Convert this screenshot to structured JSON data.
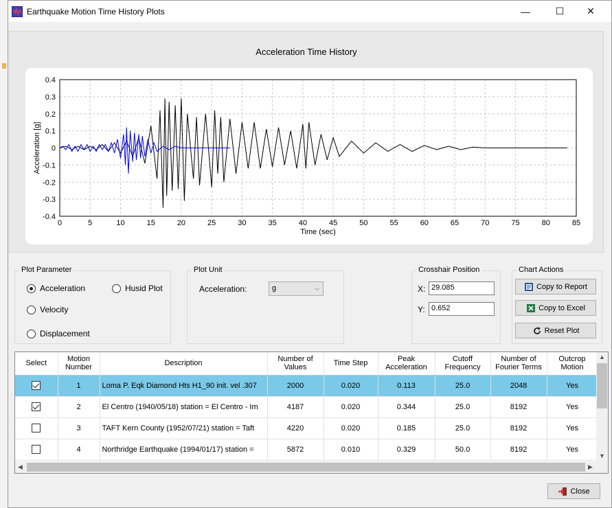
{
  "window": {
    "title": "Earthquake Motion Time History Plots",
    "controls": {
      "minimize": "—",
      "maximize": "☐",
      "close": "✕"
    }
  },
  "chart_data": {
    "type": "line",
    "title": "Acceleration Time History",
    "xlabel": "Time (sec)",
    "ylabel": "Acceleration [g]",
    "xlim": [
      0,
      85
    ],
    "ylim": [
      -0.4,
      0.4
    ],
    "xticks": [
      "0",
      "5",
      "10",
      "15",
      "20",
      "25",
      "30",
      "35",
      "40",
      "45",
      "50",
      "55",
      "60",
      "65",
      "70",
      "75",
      "80",
      "85"
    ],
    "yticks": [
      "0.4",
      "0.3",
      "0.2",
      "0.1",
      "0",
      "-0.1",
      "-0.2",
      "-0.3",
      "-0.4"
    ],
    "grid": true,
    "series": [
      {
        "color": "#000000",
        "x": [
          0,
          1,
          2,
          3,
          4,
          5,
          6,
          7,
          8,
          9,
          10,
          11,
          12,
          13,
          14,
          15,
          16,
          16.5,
          17,
          17.3,
          17.6,
          18,
          18.5,
          19,
          19.5,
          20,
          20.5,
          21,
          22,
          22.5,
          23,
          24,
          25,
          25.5,
          26,
          26.5,
          27,
          28,
          29,
          30,
          31,
          32,
          33,
          34,
          35,
          36,
          37,
          38,
          39,
          40,
          40.5,
          41,
          42,
          43,
          44,
          45,
          46,
          48,
          50,
          52,
          54,
          56,
          58,
          60,
          62,
          64,
          66,
          68,
          70,
          75,
          80,
          83.5
        ],
        "y": [
          0,
          0.01,
          -0.01,
          0.01,
          -0.01,
          0.01,
          -0.01,
          0.02,
          -0.02,
          0.03,
          -0.03,
          0.04,
          -0.05,
          0.06,
          -0.09,
          0.13,
          -0.18,
          0.22,
          -0.35,
          0.29,
          -0.28,
          0.27,
          -0.25,
          0.25,
          -0.24,
          0.29,
          -0.31,
          0.2,
          -0.18,
          0.18,
          -0.22,
          0.2,
          -0.23,
          0.22,
          -0.15,
          0.18,
          -0.2,
          0.17,
          -0.15,
          0.15,
          -0.12,
          0.15,
          -0.12,
          0.11,
          -0.11,
          0.12,
          -0.1,
          0.1,
          -0.12,
          0.14,
          -0.12,
          0.15,
          -0.1,
          0.08,
          -0.07,
          0.06,
          -0.05,
          0.04,
          -0.03,
          0.03,
          -0.02,
          0.02,
          -0.02,
          0.015,
          -0.01,
          0.01,
          -0.01,
          0.005,
          0,
          0,
          0,
          0
        ]
      },
      {
        "color": "#0000ff",
        "x": [
          0,
          0.5,
          1,
          1.5,
          2,
          2.5,
          3,
          3.5,
          4,
          4.5,
          5,
          5.5,
          6,
          6.5,
          7,
          7.5,
          8,
          8.5,
          9,
          9.5,
          10,
          10.5,
          10.8,
          11,
          11.3,
          11.6,
          12,
          12.3,
          12.6,
          13,
          13.3,
          13.6,
          14,
          14.5,
          15,
          15.5,
          16,
          17,
          18,
          19,
          20,
          22,
          24,
          26,
          28
        ],
        "y": [
          0,
          0.01,
          -0.01,
          0.02,
          -0.02,
          0.01,
          -0.02,
          0.02,
          -0.01,
          0.02,
          -0.02,
          0.01,
          -0.02,
          0.02,
          -0.01,
          0.02,
          -0.02,
          0.03,
          -0.03,
          0.05,
          -0.06,
          0.08,
          -0.1,
          0.12,
          -0.15,
          0.1,
          -0.08,
          0.09,
          -0.07,
          0.08,
          -0.06,
          0.07,
          -0.05,
          0.05,
          -0.03,
          0.03,
          -0.02,
          0.01,
          -0.01,
          0.01,
          0,
          0,
          0,
          0,
          0
        ]
      }
    ]
  },
  "plot_parameter": {
    "title": "Plot Parameter",
    "options": [
      "Acceleration",
      "Velocity",
      "Displacement",
      "Husid Plot"
    ],
    "selected": "Acceleration"
  },
  "plot_unit": {
    "title": "Plot Unit",
    "label": "Acceleration:",
    "value": "g"
  },
  "crosshair": {
    "title": "Crosshair Position",
    "x_label": "X:",
    "x_value": "29.085",
    "y_label": "Y:",
    "y_value": "0.652"
  },
  "chart_actions": {
    "title": "Chart Actions",
    "copy_report": "Copy to Report",
    "copy_excel": "Copy to Excel",
    "reset_plot": "Reset Plot",
    "colors": {
      "excel": "#1f7a3f",
      "report": "#2b5797"
    }
  },
  "table": {
    "headers": [
      "Select",
      "Motion Number",
      "Description",
      "Number of Values",
      "Time Step",
      "Peak Acceleration",
      "Cutoff Frequency",
      "Number of Fourier Terms",
      "Outcrop Motion"
    ],
    "rows": [
      {
        "checked": true,
        "selected": true,
        "cells": [
          "1",
          "Loma P. Eqk Diamond Hts H1_90 init. vel .307",
          "2000",
          "0.020",
          "0.113",
          "25.0",
          "2048",
          "Yes"
        ]
      },
      {
        "checked": true,
        "selected": false,
        "cells": [
          "2",
          "El Centro (1940/05/18) station = El Centro - Im",
          "4187",
          "0.020",
          "0.344",
          "25.0",
          "8192",
          "Yes"
        ]
      },
      {
        "checked": false,
        "selected": false,
        "cells": [
          "3",
          "TAFT Kern County (1952/07/21) station = Taft",
          "4220",
          "0.020",
          "0.185",
          "25.0",
          "8192",
          "Yes"
        ]
      },
      {
        "checked": false,
        "selected": false,
        "cells": [
          "4",
          "Northridge Earthquake (1994/01/17) station =",
          "5872",
          "0.010",
          "0.329",
          "50.0",
          "8192",
          "Yes"
        ]
      }
    ],
    "selected_color": "#7ac9e9"
  },
  "close_button": {
    "label": "Close",
    "color": "#c0392b"
  }
}
